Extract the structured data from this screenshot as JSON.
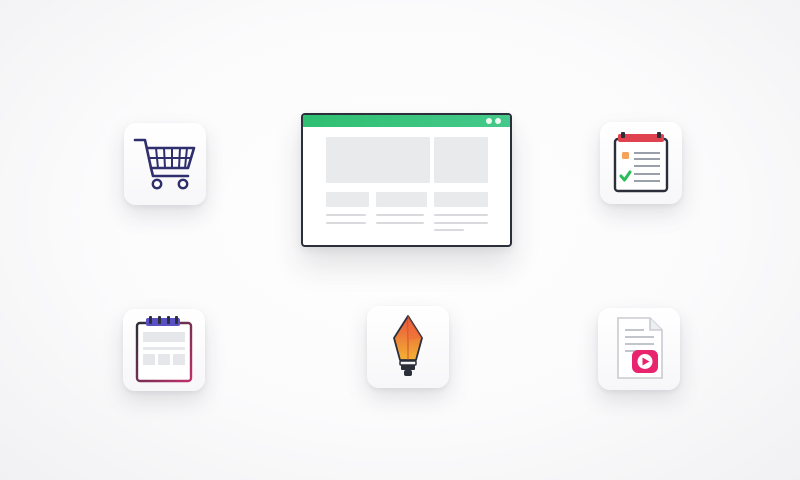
{
  "scene": {
    "tiles": [
      {
        "id": "cart",
        "icon": "shopping-cart-icon"
      },
      {
        "id": "checklist",
        "icon": "checklist-clipboard-icon"
      },
      {
        "id": "notepad",
        "icon": "notepad-icon"
      },
      {
        "id": "pen",
        "icon": "pen-nib-icon"
      },
      {
        "id": "video",
        "icon": "video-document-icon"
      }
    ],
    "center": {
      "icon": "browser-wireframe-icon"
    }
  },
  "colors": {
    "window_bar": "#2fbf71",
    "window_border": "#2b2f3a",
    "cart": "#2f2f6e",
    "checklist_header": "#e0424f",
    "checklist_check": "#2bbd5a",
    "checklist_bullet": "#f5a35a",
    "notepad_rings": "#5b4fc4",
    "notepad_accent": "#c0306b",
    "pen_top": "#e8513c",
    "pen_bottom": "#f3b233",
    "video_play": "#e8246e"
  }
}
